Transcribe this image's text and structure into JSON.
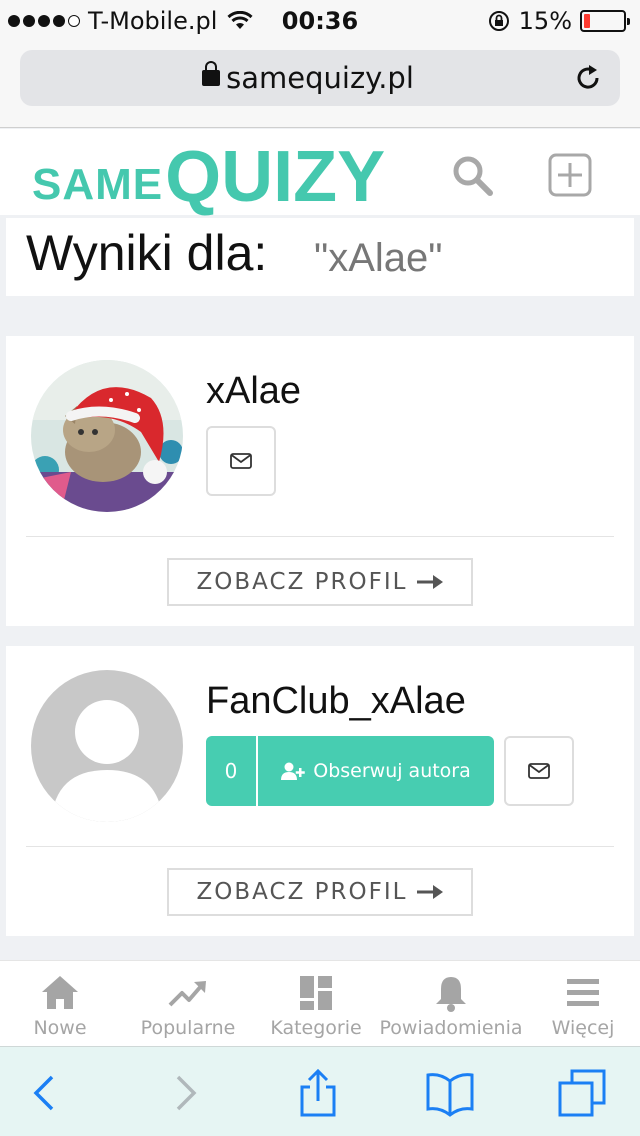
{
  "status_bar": {
    "carrier": "T-Mobile.pl",
    "time": "00:36",
    "battery_percent": "15%",
    "battery_level": 0.15
  },
  "url_bar": {
    "url": "samequizy.pl"
  },
  "site": {
    "logo_small": "SAME",
    "logo_big": "QUIZY",
    "accent_color": "#45c8ae"
  },
  "results": {
    "label": "Wyniki dla:",
    "query": "\"xAlae\""
  },
  "users": [
    {
      "name": "xAlae",
      "profile_button": "ZOBACZ PROFIL"
    },
    {
      "name": "FanClub_xAlae",
      "followers": "0",
      "follow_label": "Obserwuj autora",
      "profile_button": "ZOBACZ PROFIL"
    }
  ],
  "bottom_nav": [
    {
      "label": "Nowe",
      "icon": "home-icon"
    },
    {
      "label": "Popularne",
      "icon": "trending-icon"
    },
    {
      "label": "Kategorie",
      "icon": "grid-icon"
    },
    {
      "label": "Powiadomienia",
      "icon": "bell-icon"
    },
    {
      "label": "Więcej",
      "icon": "menu-icon"
    }
  ]
}
